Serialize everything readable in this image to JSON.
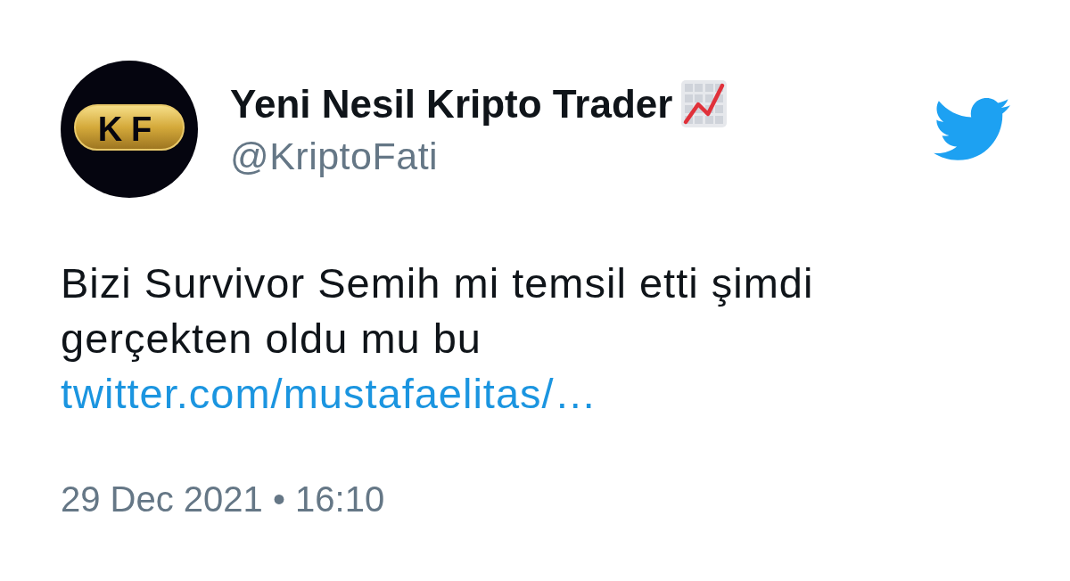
{
  "author": {
    "avatar": {
      "logo_text": "KF"
    },
    "name": "Yeni Nesil Kripto Trader",
    "handle": "@KriptoFati"
  },
  "tweet": {
    "text": "Bizi Survivor Semih mi temsil etti şimdi gerçekten oldu mu bu",
    "link": "twitter.com/mustafaelitas/…",
    "timestamp": "29 Dec 2021 • 16:10"
  }
}
